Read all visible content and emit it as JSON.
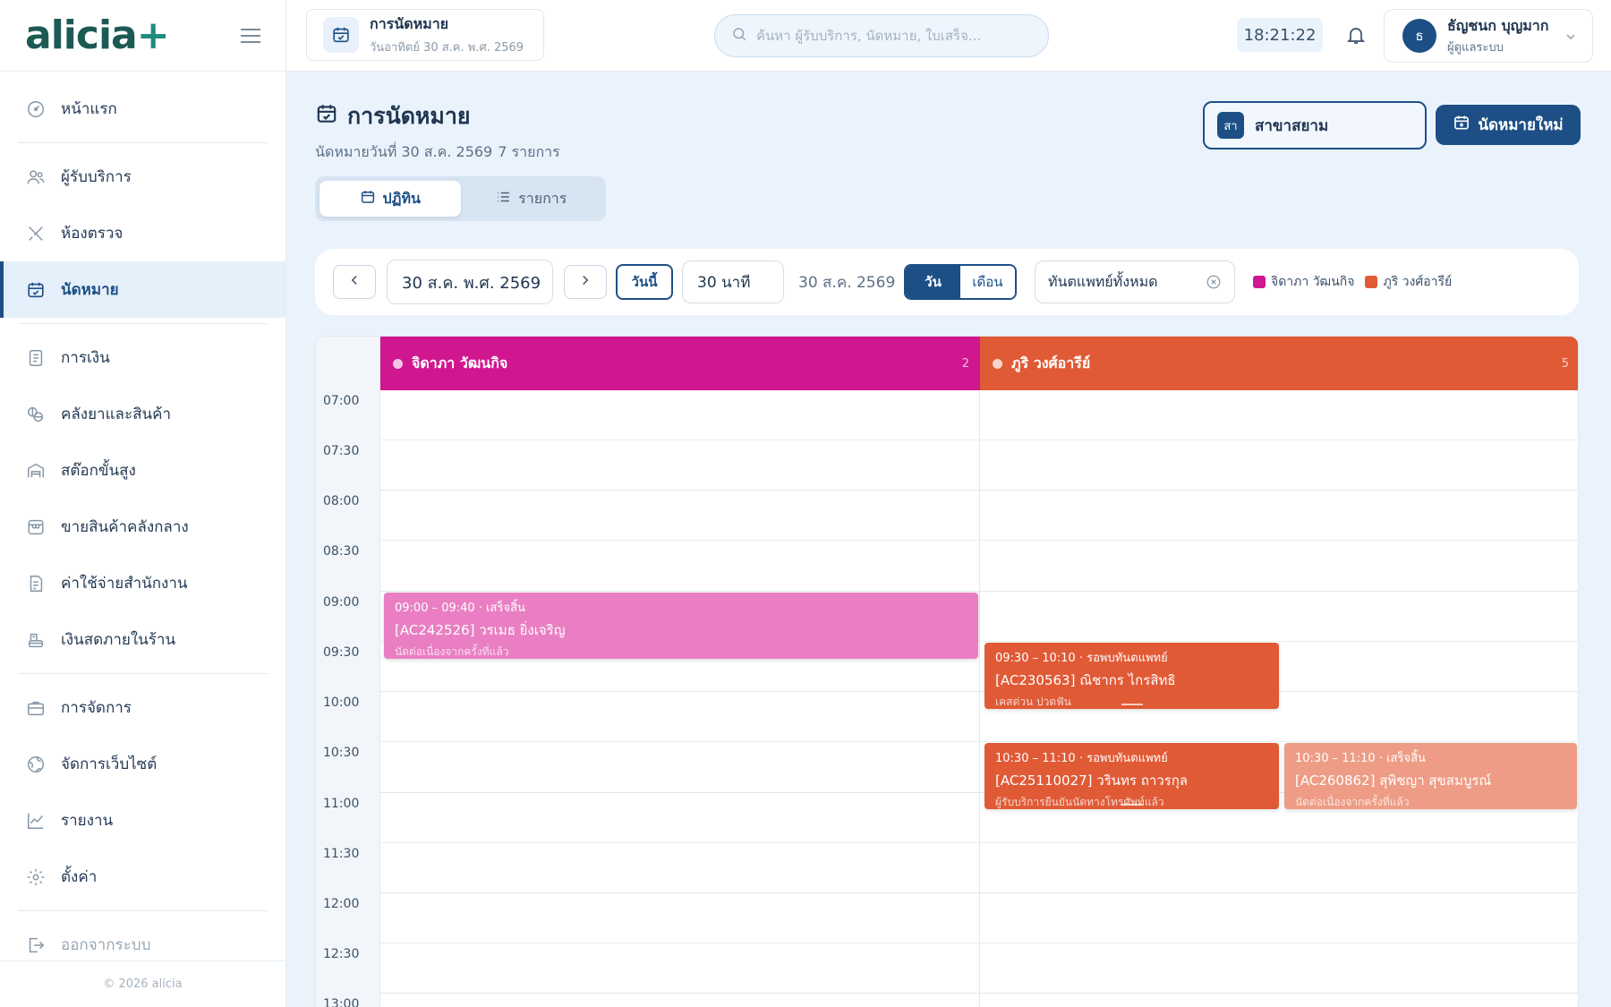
{
  "app": {
    "logo_text": "alicia",
    "logo_plus": "+"
  },
  "sidebar": {
    "items": [
      {
        "label": "หน้าแรก",
        "icon": "dashboard-gauge-icon"
      },
      {
        "label": "ผู้รับบริการ",
        "icon": "users-icon"
      },
      {
        "label": "ห้องตรวจ",
        "icon": "dental-tools-icon"
      },
      {
        "label": "นัดหมาย",
        "icon": "calendar-icon",
        "active": true
      },
      {
        "label": "การเงิน",
        "icon": "document-icon"
      },
      {
        "label": "คลังยาและสินค้า",
        "icon": "pills-icon"
      },
      {
        "label": "สต๊อกขั้นสูง",
        "icon": "warehouse-icon"
      },
      {
        "label": "ขายสินค้าคลังกลาง",
        "icon": "store-icon"
      },
      {
        "label": "ค่าใช้จ่ายสำนักงาน",
        "icon": "receipt-icon"
      },
      {
        "label": "เงินสดภายในร้าน",
        "icon": "cash-register-icon"
      },
      {
        "label": "การจัดการ",
        "icon": "briefcase-icon"
      },
      {
        "label": "จัดการเว็บไซต์",
        "icon": "globe-icon"
      },
      {
        "label": "รายงาน",
        "icon": "chart-line-icon"
      },
      {
        "label": "ตั้งค่า",
        "icon": "gear-icon"
      },
      {
        "label": "ออกจากระบบ",
        "icon": "logout-icon"
      }
    ],
    "copyright": "© 2026 alicia"
  },
  "topbar": {
    "page_title": "การนัดหมาย",
    "page_date": "วันอาทิตย์ 30 ส.ค. พ.ศ. 2569",
    "search_placeholder": "ค้นหา ผู้รับบริการ, นัดหมาย, ใบเสร็จ...",
    "clock": "18:21:22",
    "user_initial": "ธ",
    "user_name": "ธัญชนก บุญมาก",
    "user_role": "ผู้ดูแลระบบ"
  },
  "header": {
    "title": "การนัดหมาย",
    "subtitle": "นัดหมายวันที่ 30 ส.ค. 2569",
    "count": "7 รายการ",
    "branch_badge": "สา",
    "branch_label": "สาขาสยาม",
    "new_button": "นัดหมายใหม่"
  },
  "view_tabs": {
    "calendar": "ปฏิทิน",
    "list": "รายการ"
  },
  "toolbar": {
    "date_value": "30 ส.ค. พ.ศ. 2569",
    "today": "วันนี้",
    "interval": "30 นาที",
    "date_label": "30 ส.ค. 2569",
    "view_day": "วัน",
    "view_month": "เดือน",
    "dentist_filter": "ทันตแพทย์ทั้งหมด",
    "legend": [
      {
        "name": "จิดาภา วัฒนกิจ",
        "color": "#d0178f"
      },
      {
        "name": "ภูริ วงศ์อารีย์",
        "color": "#e05a36"
      }
    ]
  },
  "calendar": {
    "columns": [
      {
        "name": "จิดาภา วัฒนกิจ",
        "count": "2",
        "color": "#d0178f"
      },
      {
        "name": "ภูริ วงศ์อารีย์",
        "count": "5",
        "color": "#e05a36"
      }
    ],
    "slots": [
      "07:00",
      "07:30",
      "08:00",
      "08:30",
      "09:00",
      "09:30",
      "10:00",
      "10:30",
      "11:00",
      "11:30",
      "12:00",
      "12:30",
      "13:00"
    ],
    "appointments": [
      {
        "time": "09:00 – 09:40 · เสร็จสิ้น",
        "patient": "[AC242526] วรเมธ ยิ่งเจริญ",
        "note": "นัดต่อเนื่องจากครั้งที่แล้ว",
        "color": "#e97fc2"
      },
      {
        "time": "09:30 – 10:10 · รอพบทันตแพทย์",
        "patient": "[AC230563] ณิชากร ไกรสิทธิ",
        "note": "เคสด่วน ปวดฟัน",
        "color": "#e05a36"
      },
      {
        "time": "10:30 – 11:10 · รอพบทันตแพทย์",
        "patient": "[AC25110027] วรินทร ถาวรกุล",
        "note": "ผู้รับบริการยืนยันนัดทางโทรศัพท์แล้ว",
        "color": "#e05a36"
      },
      {
        "time": "10:30 – 11:10 · เสร็จสิ้น",
        "patient": "[AC260862] สุพิชญา สุขสมบูรณ์",
        "note": "นัดต่อเนื่องจากครั้งที่แล้ว",
        "color": "#ee9c85"
      }
    ]
  }
}
